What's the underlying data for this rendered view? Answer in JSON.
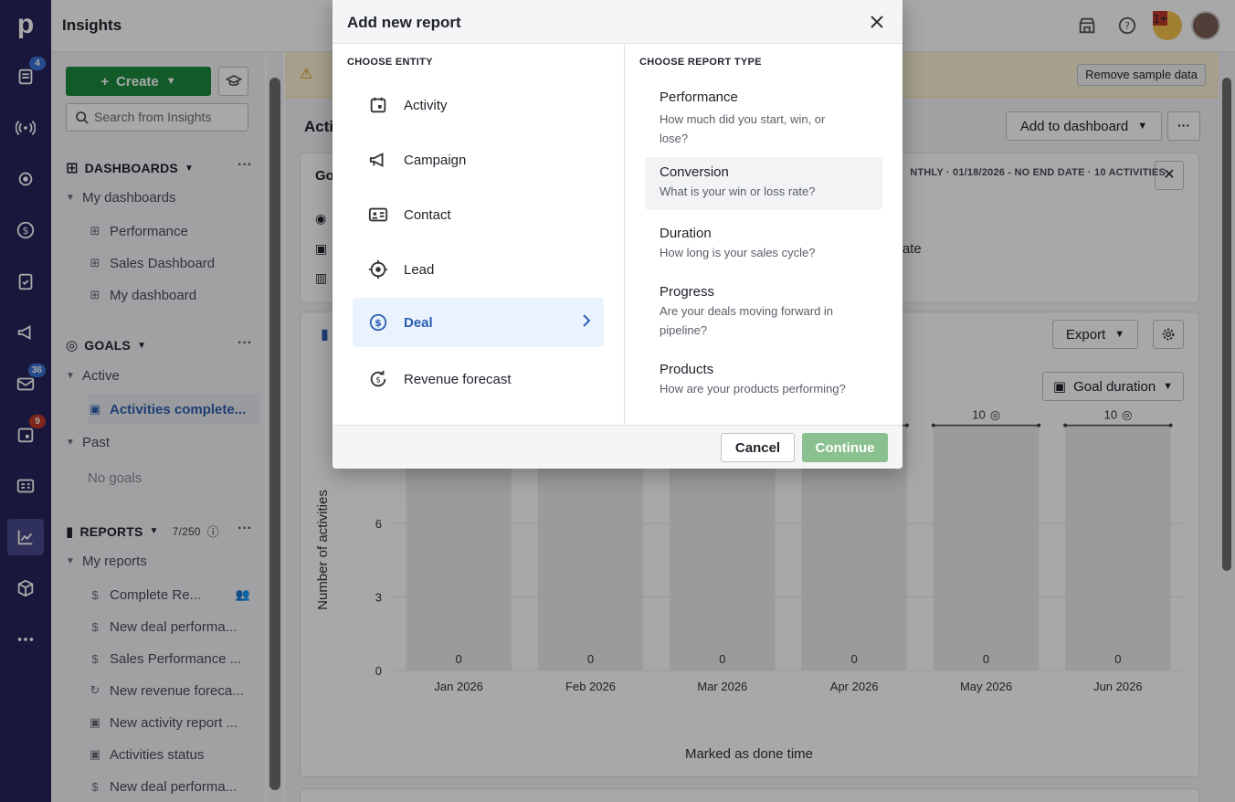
{
  "app": {
    "title": "Insights"
  },
  "rail": {
    "badges": {
      "leads": "4",
      "mail": "36",
      "calendar": "9"
    }
  },
  "header": {
    "notification_badge": "1+"
  },
  "sidebar": {
    "create_label": "Create",
    "search_placeholder": "Search from Insights",
    "dashboards": {
      "title": "DASHBOARDS",
      "group": "My dashboards",
      "items": [
        "Performance",
        "Sales Dashboard",
        "My dashboard"
      ]
    },
    "goals": {
      "title": "GOALS",
      "active_label": "Active",
      "active_items": [
        "Activities complete..."
      ],
      "past_label": "Past",
      "past_empty": "No goals"
    },
    "reports": {
      "title": "REPORTS",
      "count": "7/250",
      "group": "My reports",
      "items": [
        "Complete Re...",
        "New deal performa...",
        "Sales Performance ...",
        "New revenue foreca...",
        "New activity report ...",
        "Activities status",
        "New deal performa..."
      ]
    }
  },
  "main": {
    "banner_button": "Remove sample data",
    "title_partial": "Acti",
    "add_to_dashboard": "Add to dashboard",
    "goal_title_partial": "Go",
    "goal_meta": "NTHLY ·  01/18/2026 - NO END DATE  ·  10 ACTIVITIES",
    "goal_end_text": "l date",
    "export_label": "Export",
    "duration_label": "Goal duration"
  },
  "chart_data": {
    "type": "bar",
    "categories": [
      "Jan 2026",
      "Feb 2026",
      "Mar 2026",
      "Apr 2026",
      "May 2026",
      "Jun 2026"
    ],
    "values": [
      0,
      0,
      0,
      0,
      0,
      0
    ],
    "goal_values": [
      10,
      10,
      10,
      10,
      10,
      10
    ],
    "ylabel": "Number of activities",
    "xlabel": "Marked as done time",
    "yticks": [
      0,
      3,
      6
    ],
    "ylim": [
      0,
      12
    ],
    "grid": true
  },
  "modal": {
    "title": "Add new report",
    "entity_heading": "CHOOSE ENTITY",
    "type_heading": "CHOOSE REPORT TYPE",
    "entities": [
      {
        "label": "Activity",
        "icon": "calendar-icon"
      },
      {
        "label": "Campaign",
        "icon": "megaphone-icon"
      },
      {
        "label": "Contact",
        "icon": "contact-card-icon"
      },
      {
        "label": "Lead",
        "icon": "target-icon"
      },
      {
        "label": "Deal",
        "icon": "dollar-icon"
      },
      {
        "label": "Revenue forecast",
        "icon": "revenue-forecast-icon"
      }
    ],
    "selected_entity": "Deal",
    "report_types": [
      {
        "title": "Performance",
        "desc": "How much did you start, win, or lose?"
      },
      {
        "title": "Conversion",
        "desc": "What is your win or loss rate?"
      },
      {
        "title": "Duration",
        "desc": "How long is your sales cycle?"
      },
      {
        "title": "Progress",
        "desc": "Are your deals moving forward in pipeline?"
      },
      {
        "title": "Products",
        "desc": "How are your products performing?"
      }
    ],
    "cancel_label": "Cancel",
    "continue_label": "Continue"
  },
  "colors": {
    "rail": "#26245c",
    "create": "#1c8b3e",
    "accent": "#2b5fb3",
    "continue_disabled": "#8bc190"
  }
}
